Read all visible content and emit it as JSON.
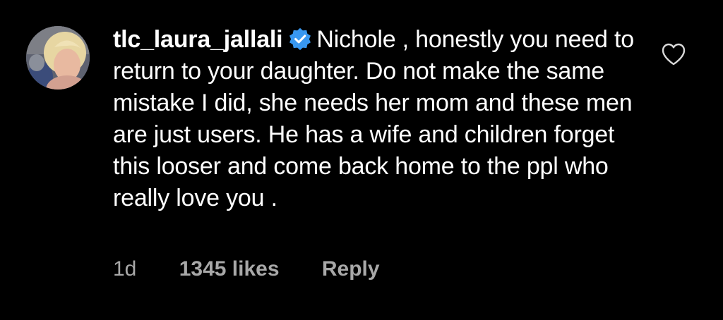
{
  "comment": {
    "username": "tlc_laura_jallali",
    "verified": true,
    "text": "Nichole , honestly you need to return to your daughter.  Do not make the same mistake I did, she needs her mom and these men are just users.  He has a wife and children forget this looser and come back home to the ppl who really love you .",
    "time": "1d",
    "likes": "1345 likes",
    "reply_label": "Reply",
    "icons": {
      "like": "heart-outline-icon",
      "verified": "verified-badge-icon"
    },
    "colors": {
      "background": "#000000",
      "text": "#ffffff",
      "meta": "#a8a8a8",
      "verified": "#3897f0"
    }
  }
}
